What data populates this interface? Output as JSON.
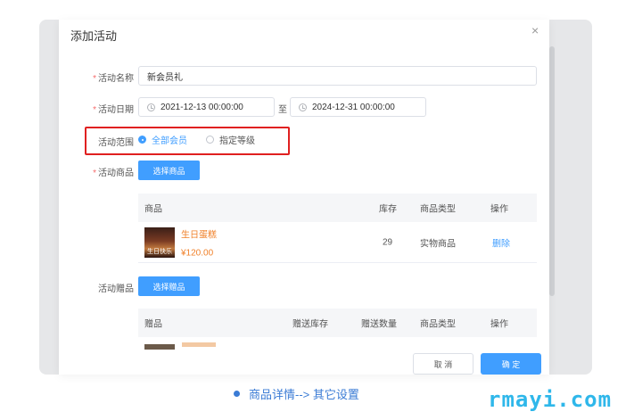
{
  "dialog": {
    "title": "添加活动",
    "close_glyph": "×"
  },
  "form": {
    "name_label": "活动名称",
    "name_value": "新会员礼",
    "date_label": "活动日期",
    "date_start": "2021-12-13 00:00:00",
    "date_separator": "至",
    "date_end": "2024-12-31 00:00:00",
    "scope_label": "活动范围",
    "scope_options": [
      {
        "label": "全部会员",
        "selected": true
      },
      {
        "label": "指定等级",
        "selected": false
      }
    ],
    "goods_label": "活动商品",
    "select_goods_button": "选择商品",
    "gift_label": "活动赠品",
    "select_gift_button": "选择赠品",
    "required_marker": "*"
  },
  "goods_table": {
    "headers": [
      "商品",
      "库存",
      "商品类型",
      "操作"
    ],
    "rows": [
      {
        "name": "生日蛋糕",
        "price": "¥120.00",
        "stock": "29",
        "type": "实物商品",
        "action": "删除",
        "thumb_caption": "生日快乐"
      }
    ]
  },
  "gift_table": {
    "headers": [
      "赠品",
      "赠送库存",
      "赠送数量",
      "商品类型",
      "操作"
    ]
  },
  "footer": {
    "cancel": "取 消",
    "confirm": "确 定"
  },
  "caption": "商品详情--> 其它设置",
  "watermark": "rmayi.com",
  "colors": {
    "primary": "#409eff",
    "highlight_border": "#e02020",
    "price": "#f0812a",
    "watermark": "#2fb7ea"
  }
}
